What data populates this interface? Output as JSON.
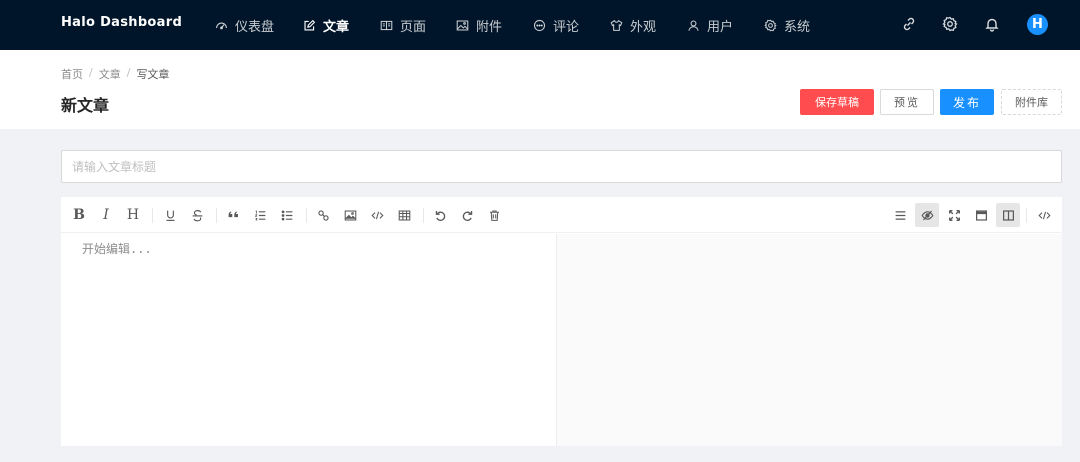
{
  "nav": {
    "brand": "Halo  Dashboard",
    "items": [
      {
        "label": "仪表盘",
        "icon": "dashboard-icon"
      },
      {
        "label": "文章",
        "icon": "edit-icon"
      },
      {
        "label": "页面",
        "icon": "book-icon"
      },
      {
        "label": "附件",
        "icon": "picture-icon"
      },
      {
        "label": "评论",
        "icon": "comment-icon"
      },
      {
        "label": "外观",
        "icon": "skin-icon"
      },
      {
        "label": "用户",
        "icon": "user-icon"
      },
      {
        "label": "系统",
        "icon": "setting-icon"
      }
    ],
    "active": "文章",
    "avatar": "H",
    "right_icons": [
      "link-icon",
      "gear-icon",
      "bell-icon"
    ]
  },
  "breadcrumb": [
    "首页",
    "文章",
    "写文章"
  ],
  "page_title": "新文章",
  "actions": {
    "save_draft": "保存草稿",
    "preview": "预览",
    "publish": "发布",
    "attachments": "附件库"
  },
  "title_input": {
    "placeholder": "请输入文章标题",
    "value": ""
  },
  "editor": {
    "placeholder": "开始编辑...",
    "toolbar_left": [
      "B",
      "I",
      "H"
    ],
    "toggled_on": [
      "preview-toggle-icon",
      "split-view-icon"
    ]
  },
  "colors": {
    "nav_bg": "#001529",
    "primary": "#1890ff",
    "danger": "#ff4d4f"
  }
}
